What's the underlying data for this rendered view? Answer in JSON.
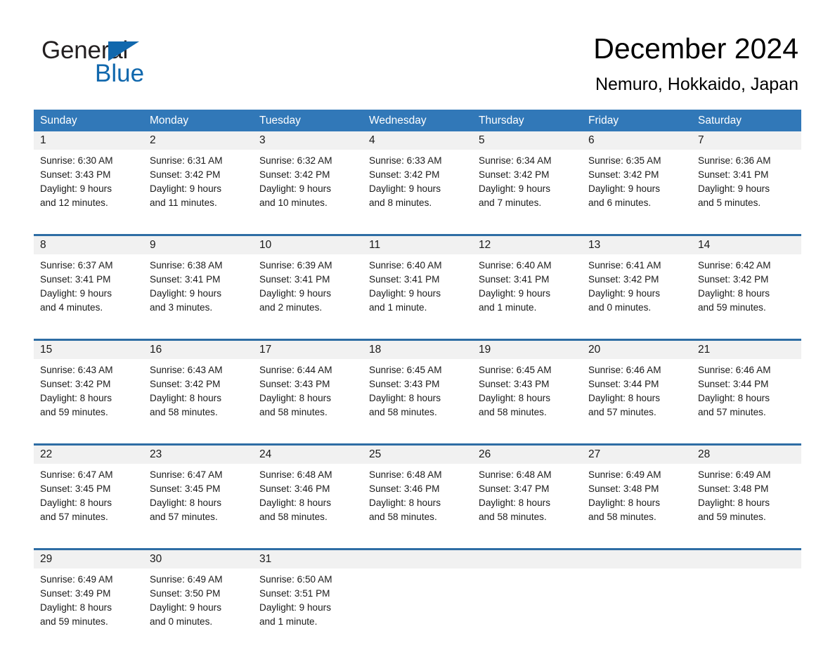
{
  "brand": {
    "name_part1": "General",
    "name_part2": "Blue",
    "accent_color": "#1168ad"
  },
  "header": {
    "month_title": "December 2024",
    "location": "Nemuro, Hokkaido, Japan"
  },
  "theme": {
    "header_blue": "#3178b8",
    "row_divider_blue": "#2e6da4",
    "daynum_band": "#f1f1f1"
  },
  "calendar": {
    "day_headers": [
      "Sunday",
      "Monday",
      "Tuesday",
      "Wednesday",
      "Thursday",
      "Friday",
      "Saturday"
    ],
    "weeks": [
      {
        "days": [
          {
            "num": "1",
            "sunrise": "Sunrise: 6:30 AM",
            "sunset": "Sunset: 3:43 PM",
            "daylight1": "Daylight: 9 hours",
            "daylight2": "and 12 minutes."
          },
          {
            "num": "2",
            "sunrise": "Sunrise: 6:31 AM",
            "sunset": "Sunset: 3:42 PM",
            "daylight1": "Daylight: 9 hours",
            "daylight2": "and 11 minutes."
          },
          {
            "num": "3",
            "sunrise": "Sunrise: 6:32 AM",
            "sunset": "Sunset: 3:42 PM",
            "daylight1": "Daylight: 9 hours",
            "daylight2": "and 10 minutes."
          },
          {
            "num": "4",
            "sunrise": "Sunrise: 6:33 AM",
            "sunset": "Sunset: 3:42 PM",
            "daylight1": "Daylight: 9 hours",
            "daylight2": "and 8 minutes."
          },
          {
            "num": "5",
            "sunrise": "Sunrise: 6:34 AM",
            "sunset": "Sunset: 3:42 PM",
            "daylight1": "Daylight: 9 hours",
            "daylight2": "and 7 minutes."
          },
          {
            "num": "6",
            "sunrise": "Sunrise: 6:35 AM",
            "sunset": "Sunset: 3:42 PM",
            "daylight1": "Daylight: 9 hours",
            "daylight2": "and 6 minutes."
          },
          {
            "num": "7",
            "sunrise": "Sunrise: 6:36 AM",
            "sunset": "Sunset: 3:41 PM",
            "daylight1": "Daylight: 9 hours",
            "daylight2": "and 5 minutes."
          }
        ]
      },
      {
        "days": [
          {
            "num": "8",
            "sunrise": "Sunrise: 6:37 AM",
            "sunset": "Sunset: 3:41 PM",
            "daylight1": "Daylight: 9 hours",
            "daylight2": "and 4 minutes."
          },
          {
            "num": "9",
            "sunrise": "Sunrise: 6:38 AM",
            "sunset": "Sunset: 3:41 PM",
            "daylight1": "Daylight: 9 hours",
            "daylight2": "and 3 minutes."
          },
          {
            "num": "10",
            "sunrise": "Sunrise: 6:39 AM",
            "sunset": "Sunset: 3:41 PM",
            "daylight1": "Daylight: 9 hours",
            "daylight2": "and 2 minutes."
          },
          {
            "num": "11",
            "sunrise": "Sunrise: 6:40 AM",
            "sunset": "Sunset: 3:41 PM",
            "daylight1": "Daylight: 9 hours",
            "daylight2": "and 1 minute."
          },
          {
            "num": "12",
            "sunrise": "Sunrise: 6:40 AM",
            "sunset": "Sunset: 3:41 PM",
            "daylight1": "Daylight: 9 hours",
            "daylight2": "and 1 minute."
          },
          {
            "num": "13",
            "sunrise": "Sunrise: 6:41 AM",
            "sunset": "Sunset: 3:42 PM",
            "daylight1": "Daylight: 9 hours",
            "daylight2": "and 0 minutes."
          },
          {
            "num": "14",
            "sunrise": "Sunrise: 6:42 AM",
            "sunset": "Sunset: 3:42 PM",
            "daylight1": "Daylight: 8 hours",
            "daylight2": "and 59 minutes."
          }
        ]
      },
      {
        "days": [
          {
            "num": "15",
            "sunrise": "Sunrise: 6:43 AM",
            "sunset": "Sunset: 3:42 PM",
            "daylight1": "Daylight: 8 hours",
            "daylight2": "and 59 minutes."
          },
          {
            "num": "16",
            "sunrise": "Sunrise: 6:43 AM",
            "sunset": "Sunset: 3:42 PM",
            "daylight1": "Daylight: 8 hours",
            "daylight2": "and 58 minutes."
          },
          {
            "num": "17",
            "sunrise": "Sunrise: 6:44 AM",
            "sunset": "Sunset: 3:43 PM",
            "daylight1": "Daylight: 8 hours",
            "daylight2": "and 58 minutes."
          },
          {
            "num": "18",
            "sunrise": "Sunrise: 6:45 AM",
            "sunset": "Sunset: 3:43 PM",
            "daylight1": "Daylight: 8 hours",
            "daylight2": "and 58 minutes."
          },
          {
            "num": "19",
            "sunrise": "Sunrise: 6:45 AM",
            "sunset": "Sunset: 3:43 PM",
            "daylight1": "Daylight: 8 hours",
            "daylight2": "and 58 minutes."
          },
          {
            "num": "20",
            "sunrise": "Sunrise: 6:46 AM",
            "sunset": "Sunset: 3:44 PM",
            "daylight1": "Daylight: 8 hours",
            "daylight2": "and 57 minutes."
          },
          {
            "num": "21",
            "sunrise": "Sunrise: 6:46 AM",
            "sunset": "Sunset: 3:44 PM",
            "daylight1": "Daylight: 8 hours",
            "daylight2": "and 57 minutes."
          }
        ]
      },
      {
        "days": [
          {
            "num": "22",
            "sunrise": "Sunrise: 6:47 AM",
            "sunset": "Sunset: 3:45 PM",
            "daylight1": "Daylight: 8 hours",
            "daylight2": "and 57 minutes."
          },
          {
            "num": "23",
            "sunrise": "Sunrise: 6:47 AM",
            "sunset": "Sunset: 3:45 PM",
            "daylight1": "Daylight: 8 hours",
            "daylight2": "and 57 minutes."
          },
          {
            "num": "24",
            "sunrise": "Sunrise: 6:48 AM",
            "sunset": "Sunset: 3:46 PM",
            "daylight1": "Daylight: 8 hours",
            "daylight2": "and 58 minutes."
          },
          {
            "num": "25",
            "sunrise": "Sunrise: 6:48 AM",
            "sunset": "Sunset: 3:46 PM",
            "daylight1": "Daylight: 8 hours",
            "daylight2": "and 58 minutes."
          },
          {
            "num": "26",
            "sunrise": "Sunrise: 6:48 AM",
            "sunset": "Sunset: 3:47 PM",
            "daylight1": "Daylight: 8 hours",
            "daylight2": "and 58 minutes."
          },
          {
            "num": "27",
            "sunrise": "Sunrise: 6:49 AM",
            "sunset": "Sunset: 3:48 PM",
            "daylight1": "Daylight: 8 hours",
            "daylight2": "and 58 minutes."
          },
          {
            "num": "28",
            "sunrise": "Sunrise: 6:49 AM",
            "sunset": "Sunset: 3:48 PM",
            "daylight1": "Daylight: 8 hours",
            "daylight2": "and 59 minutes."
          }
        ]
      },
      {
        "days": [
          {
            "num": "29",
            "sunrise": "Sunrise: 6:49 AM",
            "sunset": "Sunset: 3:49 PM",
            "daylight1": "Daylight: 8 hours",
            "daylight2": "and 59 minutes."
          },
          {
            "num": "30",
            "sunrise": "Sunrise: 6:49 AM",
            "sunset": "Sunset: 3:50 PM",
            "daylight1": "Daylight: 9 hours",
            "daylight2": "and 0 minutes."
          },
          {
            "num": "31",
            "sunrise": "Sunrise: 6:50 AM",
            "sunset": "Sunset: 3:51 PM",
            "daylight1": "Daylight: 9 hours",
            "daylight2": "and 1 minute."
          },
          {
            "num": "",
            "sunrise": "",
            "sunset": "",
            "daylight1": "",
            "daylight2": ""
          },
          {
            "num": "",
            "sunrise": "",
            "sunset": "",
            "daylight1": "",
            "daylight2": ""
          },
          {
            "num": "",
            "sunrise": "",
            "sunset": "",
            "daylight1": "",
            "daylight2": ""
          },
          {
            "num": "",
            "sunrise": "",
            "sunset": "",
            "daylight1": "",
            "daylight2": ""
          }
        ]
      }
    ]
  }
}
